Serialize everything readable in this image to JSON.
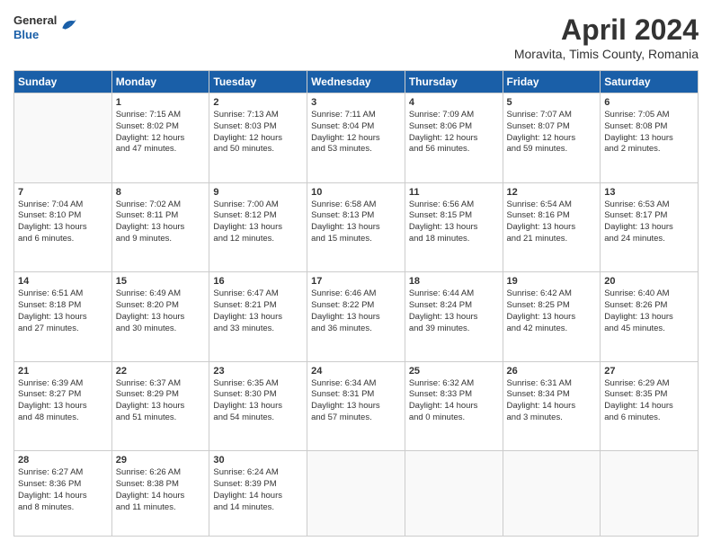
{
  "header": {
    "logo": {
      "line1": "General",
      "line2": "Blue"
    },
    "title": "April 2024",
    "subtitle": "Moravita, Timis County, Romania"
  },
  "weekdays": [
    "Sunday",
    "Monday",
    "Tuesday",
    "Wednesday",
    "Thursday",
    "Friday",
    "Saturday"
  ],
  "weeks": [
    [
      {
        "day": "",
        "content": ""
      },
      {
        "day": "1",
        "content": "Sunrise: 7:15 AM\nSunset: 8:02 PM\nDaylight: 12 hours\nand 47 minutes."
      },
      {
        "day": "2",
        "content": "Sunrise: 7:13 AM\nSunset: 8:03 PM\nDaylight: 12 hours\nand 50 minutes."
      },
      {
        "day": "3",
        "content": "Sunrise: 7:11 AM\nSunset: 8:04 PM\nDaylight: 12 hours\nand 53 minutes."
      },
      {
        "day": "4",
        "content": "Sunrise: 7:09 AM\nSunset: 8:06 PM\nDaylight: 12 hours\nand 56 minutes."
      },
      {
        "day": "5",
        "content": "Sunrise: 7:07 AM\nSunset: 8:07 PM\nDaylight: 12 hours\nand 59 minutes."
      },
      {
        "day": "6",
        "content": "Sunrise: 7:05 AM\nSunset: 8:08 PM\nDaylight: 13 hours\nand 2 minutes."
      }
    ],
    [
      {
        "day": "7",
        "content": "Sunrise: 7:04 AM\nSunset: 8:10 PM\nDaylight: 13 hours\nand 6 minutes."
      },
      {
        "day": "8",
        "content": "Sunrise: 7:02 AM\nSunset: 8:11 PM\nDaylight: 13 hours\nand 9 minutes."
      },
      {
        "day": "9",
        "content": "Sunrise: 7:00 AM\nSunset: 8:12 PM\nDaylight: 13 hours\nand 12 minutes."
      },
      {
        "day": "10",
        "content": "Sunrise: 6:58 AM\nSunset: 8:13 PM\nDaylight: 13 hours\nand 15 minutes."
      },
      {
        "day": "11",
        "content": "Sunrise: 6:56 AM\nSunset: 8:15 PM\nDaylight: 13 hours\nand 18 minutes."
      },
      {
        "day": "12",
        "content": "Sunrise: 6:54 AM\nSunset: 8:16 PM\nDaylight: 13 hours\nand 21 minutes."
      },
      {
        "day": "13",
        "content": "Sunrise: 6:53 AM\nSunset: 8:17 PM\nDaylight: 13 hours\nand 24 minutes."
      }
    ],
    [
      {
        "day": "14",
        "content": "Sunrise: 6:51 AM\nSunset: 8:18 PM\nDaylight: 13 hours\nand 27 minutes."
      },
      {
        "day": "15",
        "content": "Sunrise: 6:49 AM\nSunset: 8:20 PM\nDaylight: 13 hours\nand 30 minutes."
      },
      {
        "day": "16",
        "content": "Sunrise: 6:47 AM\nSunset: 8:21 PM\nDaylight: 13 hours\nand 33 minutes."
      },
      {
        "day": "17",
        "content": "Sunrise: 6:46 AM\nSunset: 8:22 PM\nDaylight: 13 hours\nand 36 minutes."
      },
      {
        "day": "18",
        "content": "Sunrise: 6:44 AM\nSunset: 8:24 PM\nDaylight: 13 hours\nand 39 minutes."
      },
      {
        "day": "19",
        "content": "Sunrise: 6:42 AM\nSunset: 8:25 PM\nDaylight: 13 hours\nand 42 minutes."
      },
      {
        "day": "20",
        "content": "Sunrise: 6:40 AM\nSunset: 8:26 PM\nDaylight: 13 hours\nand 45 minutes."
      }
    ],
    [
      {
        "day": "21",
        "content": "Sunrise: 6:39 AM\nSunset: 8:27 PM\nDaylight: 13 hours\nand 48 minutes."
      },
      {
        "day": "22",
        "content": "Sunrise: 6:37 AM\nSunset: 8:29 PM\nDaylight: 13 hours\nand 51 minutes."
      },
      {
        "day": "23",
        "content": "Sunrise: 6:35 AM\nSunset: 8:30 PM\nDaylight: 13 hours\nand 54 minutes."
      },
      {
        "day": "24",
        "content": "Sunrise: 6:34 AM\nSunset: 8:31 PM\nDaylight: 13 hours\nand 57 minutes."
      },
      {
        "day": "25",
        "content": "Sunrise: 6:32 AM\nSunset: 8:33 PM\nDaylight: 14 hours\nand 0 minutes."
      },
      {
        "day": "26",
        "content": "Sunrise: 6:31 AM\nSunset: 8:34 PM\nDaylight: 14 hours\nand 3 minutes."
      },
      {
        "day": "27",
        "content": "Sunrise: 6:29 AM\nSunset: 8:35 PM\nDaylight: 14 hours\nand 6 minutes."
      }
    ],
    [
      {
        "day": "28",
        "content": "Sunrise: 6:27 AM\nSunset: 8:36 PM\nDaylight: 14 hours\nand 8 minutes."
      },
      {
        "day": "29",
        "content": "Sunrise: 6:26 AM\nSunset: 8:38 PM\nDaylight: 14 hours\nand 11 minutes."
      },
      {
        "day": "30",
        "content": "Sunrise: 6:24 AM\nSunset: 8:39 PM\nDaylight: 14 hours\nand 14 minutes."
      },
      {
        "day": "",
        "content": ""
      },
      {
        "day": "",
        "content": ""
      },
      {
        "day": "",
        "content": ""
      },
      {
        "day": "",
        "content": ""
      }
    ]
  ]
}
